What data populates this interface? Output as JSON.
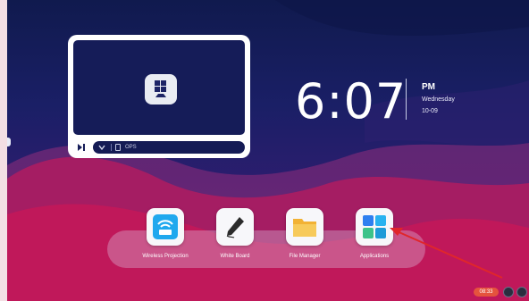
{
  "preview": {
    "source_label": "OPS",
    "icons": {
      "center": "windows-monitor-icon",
      "play": "play-pause-icon",
      "dropdown": "chevron-down-icon",
      "source": "ops-device-icon"
    }
  },
  "clock": {
    "time": "6:07",
    "ampm": "PM",
    "weekday": "Wednesday",
    "date": "10-09"
  },
  "dock": {
    "apps": [
      {
        "label": "Wireless Projection",
        "icon": "wireless-projection-icon"
      },
      {
        "label": "White Board",
        "icon": "pen-icon"
      },
      {
        "label": "File Manager",
        "icon": "folder-icon"
      },
      {
        "label": "Applications",
        "icon": "apps-grid-icon"
      }
    ]
  },
  "status": {
    "pill_text": "08:33"
  },
  "colors": {
    "accent": "#e5533d",
    "background_top": "#101a4e",
    "wave": "#c0185a",
    "arrow": "#e0262b"
  }
}
